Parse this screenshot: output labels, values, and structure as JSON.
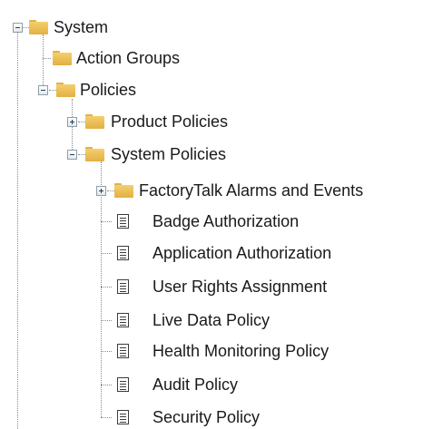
{
  "tree": {
    "system": {
      "label": "System",
      "icon": "folder-icon",
      "state": "expanded"
    },
    "action_groups": {
      "label": "Action Groups",
      "icon": "folder-icon"
    },
    "policies": {
      "label": "Policies",
      "icon": "folder-icon",
      "state": "expanded"
    },
    "product_policies": {
      "label": "Product Policies",
      "icon": "folder-icon",
      "state": "collapsed"
    },
    "system_policies": {
      "label": "System Policies",
      "icon": "folder-icon",
      "state": "expanded"
    },
    "factorytalk_alarms": {
      "label": "FactoryTalk Alarms and Events",
      "icon": "folder-icon",
      "state": "collapsed"
    },
    "badge_authorization": {
      "label": "Badge Authorization",
      "icon": "document-icon"
    },
    "application_authorization": {
      "label": "Application Authorization",
      "icon": "document-icon"
    },
    "user_rights_assignment": {
      "label": "User Rights Assignment",
      "icon": "document-icon"
    },
    "live_data_policy": {
      "label": "Live Data Policy",
      "icon": "document-icon"
    },
    "health_monitoring_policy": {
      "label": "Health Monitoring Policy",
      "icon": "document-icon"
    },
    "audit_policy": {
      "label": "Audit Policy",
      "icon": "document-icon"
    },
    "security_policy": {
      "label": "Security Policy",
      "icon": "document-icon"
    }
  }
}
